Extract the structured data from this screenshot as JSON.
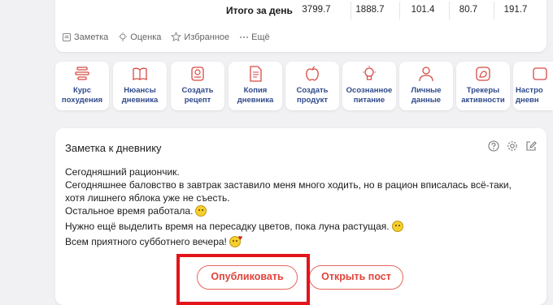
{
  "totals": {
    "label": "Итого за день",
    "values": [
      "3799.7",
      "1888.7",
      "101.4",
      "80.7",
      "191.7"
    ]
  },
  "actions": {
    "note": "Заметка",
    "rate": "Оценка",
    "favorite": "Избранное",
    "more": "Ещё"
  },
  "tiles": [
    {
      "line1": "Курс",
      "line2": "похудения",
      "icon": "scale-icon"
    },
    {
      "line1": "Нюансы",
      "line2": "дневника",
      "icon": "book-icon"
    },
    {
      "line1": "Создать",
      "line2": "рецепт",
      "icon": "recipe-icon"
    },
    {
      "line1": "Копия",
      "line2": "дневника",
      "icon": "document-icon"
    },
    {
      "line1": "Создать",
      "line2": "продукт",
      "icon": "apple-icon"
    },
    {
      "line1": "Осознанное",
      "line2": "питание",
      "icon": "bulb-icon"
    },
    {
      "line1": "Личные",
      "line2": "данные",
      "icon": "user-icon"
    },
    {
      "line1": "Трекеры",
      "line2": "активности",
      "icon": "muscle-icon"
    },
    {
      "line1": "Настро",
      "line2": "дневн",
      "icon": "settings-icon"
    }
  ],
  "note": {
    "title": "Заметка к дневнику",
    "lines": [
      "Сегодняшний рациончик.",
      "Сегодняшнее баловство в завтрак заставило меня много ходить, но в рацион вписалась всё-таки,",
      "хотя лишнего яблока уже не съесть.",
      "Остальное время работала.",
      "Нужно ещё выделить время на пересадку цветов, пока луна растущая.",
      "Всем приятного субботнего вечера!"
    ]
  },
  "buttons": {
    "publish": "Опубликовать",
    "open_post": "Открыть пост"
  },
  "colors": {
    "accent": "#e0443b",
    "tile_text": "#2f4a8a",
    "highlight": "#e4141b"
  }
}
